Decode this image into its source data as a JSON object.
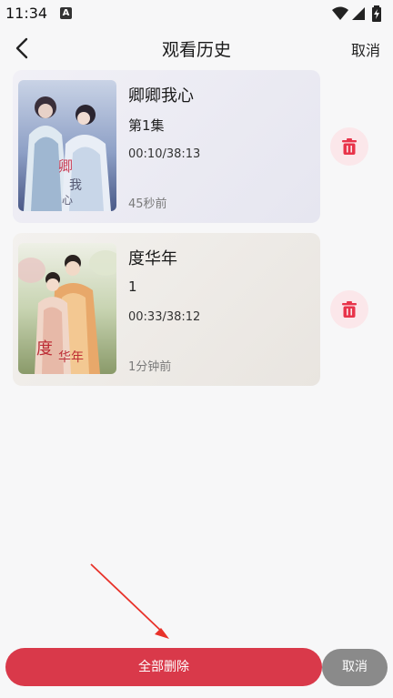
{
  "status_bar": {
    "time": "11:34",
    "notification_badge": "A"
  },
  "header": {
    "title": "观看历史",
    "cancel_label": "取消"
  },
  "history": [
    {
      "title": "卿卿我心",
      "episode": "第1集",
      "progress": "00:10/38:13",
      "ago": "45秒前"
    },
    {
      "title": "度华年",
      "episode": "1",
      "progress": "00:33/38:12",
      "ago": "1分钟前"
    }
  ],
  "bottom_bar": {
    "delete_all_label": "全部删除",
    "cancel_label": "取消"
  },
  "colors": {
    "accent": "#d9394a",
    "delete_icon": "#e8344a",
    "delete_bg": "#fbe7ea",
    "annotation_arrow": "#e8322a"
  }
}
